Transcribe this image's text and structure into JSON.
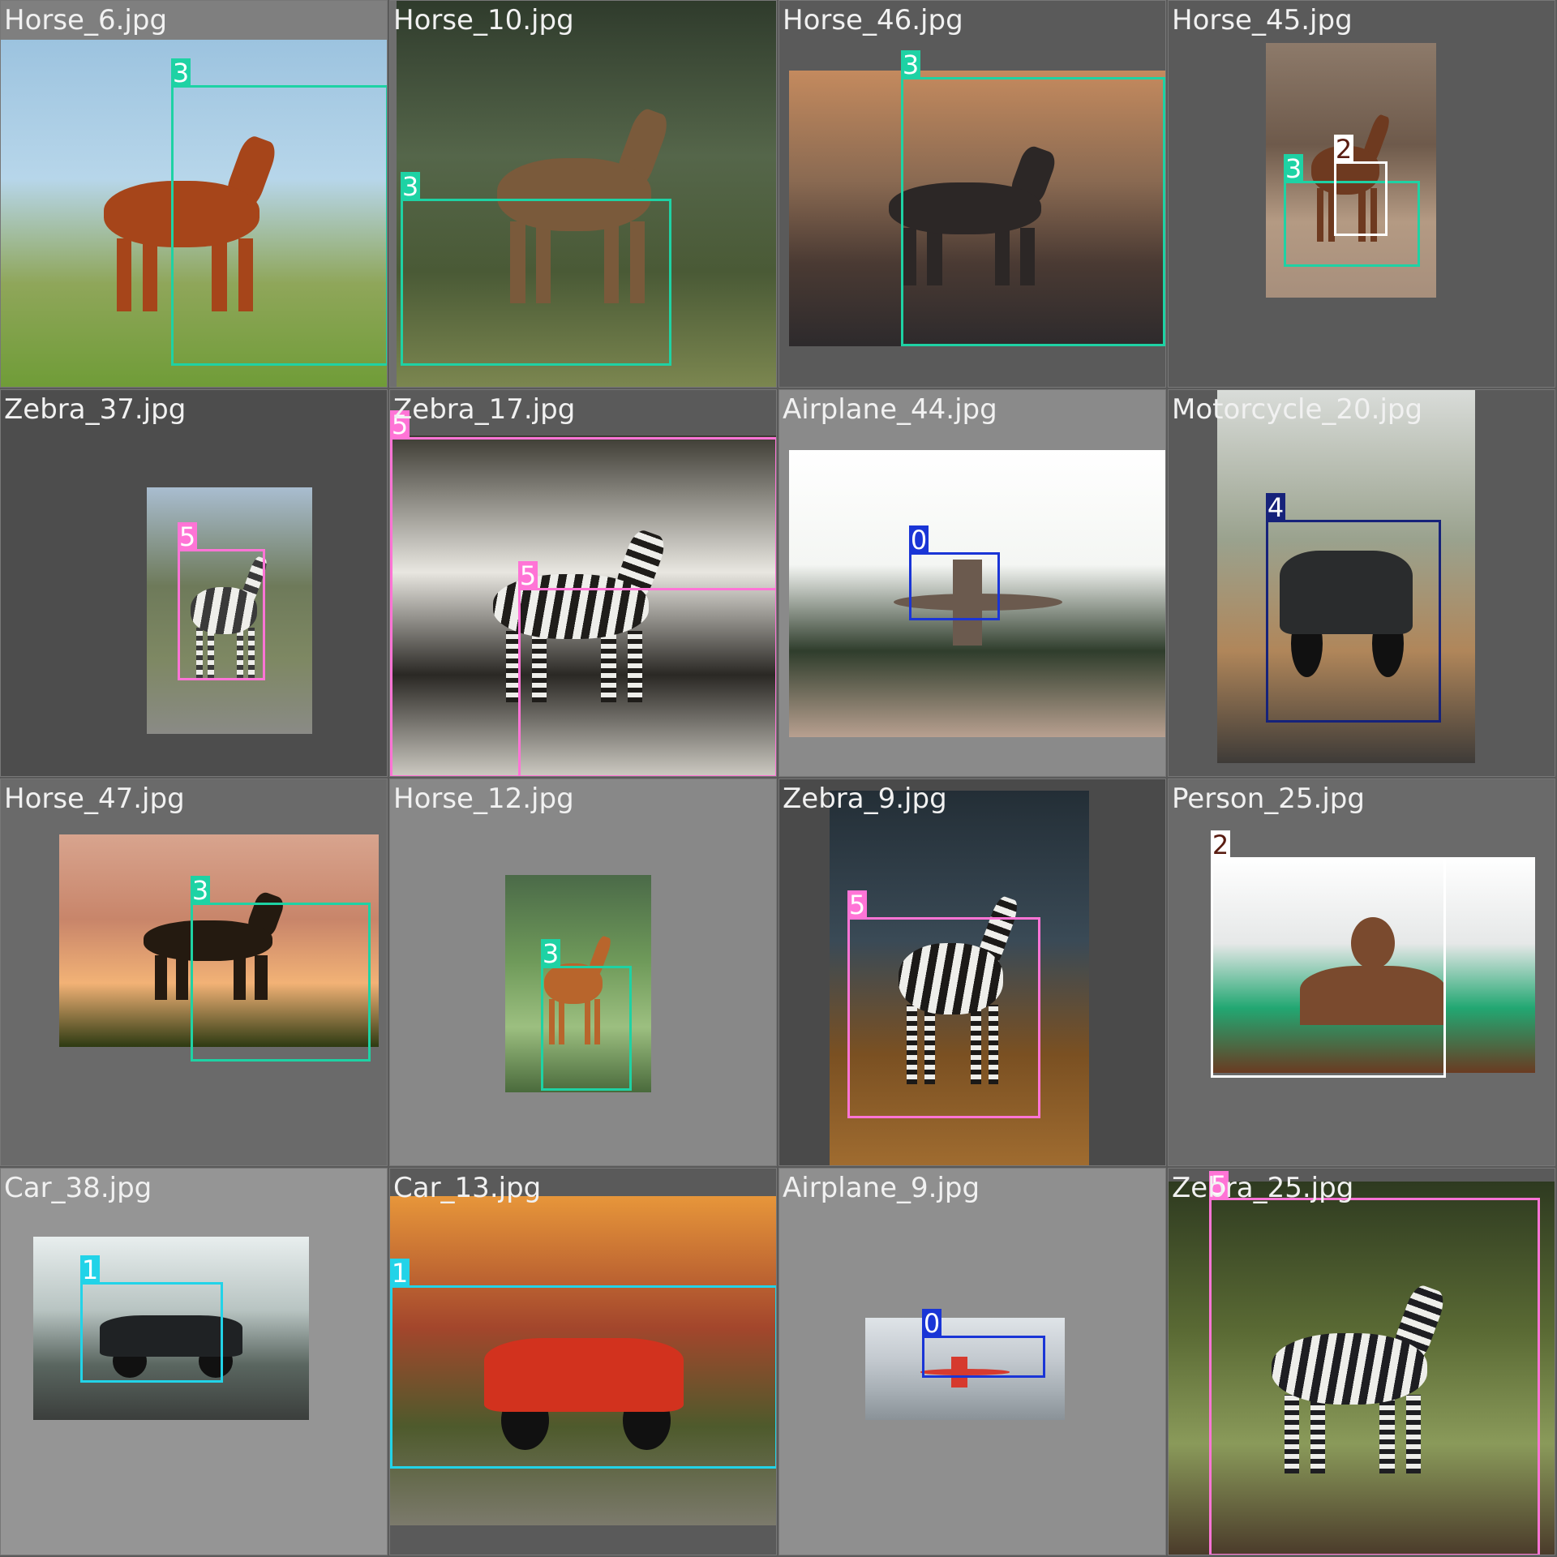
{
  "tiles": [
    {
      "filename": "Horse_6.jpg",
      "bg": "#7f7f7f",
      "photo_colors": [
        "#9cc3df",
        "#b7d6ea",
        "#8fa65a",
        "#6f9c37"
      ],
      "subject": "horse",
      "subject_color": "#a6451a",
      "boxes": [
        {
          "label": "3",
          "cls": 3
        }
      ]
    },
    {
      "filename": "Horse_10.jpg",
      "bg": "#6f6f6f",
      "photo_colors": [
        "#2f3b2c",
        "#55664a",
        "#4a5a36",
        "#7c8750"
      ],
      "subject": "horse",
      "subject_color": "#7a5a3b",
      "boxes": [
        {
          "label": "3",
          "cls": 3
        }
      ]
    },
    {
      "filename": "Horse_46.jpg",
      "bg": "#5a5a5a",
      "photo_colors": [
        "#c48a5e",
        "#8a6a52",
        "#4a3a33",
        "#2d2a2c"
      ],
      "subject": "horse",
      "subject_color": "#2c2726",
      "boxes": [
        {
          "label": "3",
          "cls": 3
        }
      ]
    },
    {
      "filename": "Horse_45.jpg",
      "bg": "#5a5a5a",
      "photo_colors": [
        "#8d7a6a",
        "#6e5a4b",
        "#b49a83",
        "#a78f7c"
      ],
      "subject": "horse",
      "subject_color": "#6e3a20",
      "boxes": [
        {
          "label": "3",
          "cls": 3
        },
        {
          "label": "2",
          "cls": 2
        }
      ]
    },
    {
      "filename": "Zebra_37.jpg",
      "bg": "#4d4d4d",
      "photo_colors": [
        "#a9bdd0",
        "#6e7a5a",
        "#7e8863",
        "#8a8a86"
      ],
      "subject": "zebra",
      "subject_color": "#3a3a3a",
      "boxes": [
        {
          "label": "5",
          "cls": 5
        }
      ]
    },
    {
      "filename": "Zebra_17.jpg",
      "bg": "#5a5a5a",
      "photo_colors": [
        "#3d3b33",
        "#e8e6e0",
        "#2a2824",
        "#cfccc4"
      ],
      "subject": "zebra",
      "subject_color": "#1f1d1a",
      "boxes": [
        {
          "label": "5",
          "cls": 5
        },
        {
          "label": "5",
          "cls": 5
        }
      ]
    },
    {
      "filename": "Airplane_44.jpg",
      "bg": "#8a8a8a",
      "photo_colors": [
        "#ffffff",
        "#f4f6f3",
        "#2f3d2c",
        "#b8a090"
      ],
      "subject": "airplane",
      "subject_color": "#6b5a4e",
      "boxes": [
        {
          "label": "0",
          "cls": 0
        }
      ]
    },
    {
      "filename": "Motorcycle_20.jpg",
      "bg": "#5a5a5a",
      "photo_colors": [
        "#d9dcd9",
        "#9aa28e",
        "#b0865a",
        "#3e3b38"
      ],
      "subject": "motorcycle",
      "subject_color": "#2a2c2d",
      "boxes": [
        {
          "label": "4",
          "cls": 4
        }
      ]
    },
    {
      "filename": "Horse_47.jpg",
      "bg": "#6a6a6a",
      "photo_colors": [
        "#d8a48e",
        "#c8856a",
        "#f2b276",
        "#2d3a12"
      ],
      "subject": "horse",
      "subject_color": "#241a10",
      "boxes": [
        {
          "label": "3",
          "cls": 3
        }
      ]
    },
    {
      "filename": "Horse_12.jpg",
      "bg": "#888888",
      "photo_colors": [
        "#4b6a48",
        "#6f9a5a",
        "#9cbf80",
        "#4a6a3c"
      ],
      "subject": "horse",
      "subject_color": "#b8652c",
      "boxes": [
        {
          "label": "3",
          "cls": 3
        }
      ]
    },
    {
      "filename": "Zebra_9.jpg",
      "bg": "#4a4a4a",
      "photo_colors": [
        "#232e36",
        "#3a4a56",
        "#7a5022",
        "#a06c30"
      ],
      "subject": "zebra",
      "subject_color": "#1c1a18",
      "boxes": [
        {
          "label": "5",
          "cls": 5
        }
      ]
    },
    {
      "filename": "Person_25.jpg",
      "bg": "#6a6a6a",
      "photo_colors": [
        "#ffffff",
        "#e6e8e8",
        "#22a772",
        "#6a3b22"
      ],
      "subject": "person",
      "subject_color": "#7a4a2e",
      "boxes": [
        {
          "label": "2",
          "cls": 2
        }
      ]
    },
    {
      "filename": "Car_38.jpg",
      "bg": "#959595",
      "photo_colors": [
        "#e8eeee",
        "#b8c4c2",
        "#5a6660",
        "#3b3e3c"
      ],
      "subject": "car",
      "subject_color": "#1f2224",
      "boxes": [
        {
          "label": "1",
          "cls": 1
        }
      ]
    },
    {
      "filename": "Car_13.jpg",
      "bg": "#5a5a5a",
      "photo_colors": [
        "#e7963a",
        "#a3462c",
        "#4e5a2c",
        "#7c7a6c"
      ],
      "subject": "car",
      "subject_color": "#d2321e",
      "boxes": [
        {
          "label": "1",
          "cls": 1
        }
      ]
    },
    {
      "filename": "Airplane_9.jpg",
      "bg": "#8f8f8f",
      "photo_colors": [
        "#dfe4e8",
        "#c4cad0",
        "#a8b0b6",
        "#8a9298"
      ],
      "subject": "airplane",
      "subject_color": "#d63a2e",
      "boxes": [
        {
          "label": "0",
          "cls": 0
        }
      ]
    },
    {
      "filename": "Zebra_25.jpg",
      "bg": "#5a5a5a",
      "photo_colors": [
        "#2e3a20",
        "#5a6a34",
        "#8a9a5a",
        "#4a3a2a"
      ],
      "subject": "zebra",
      "subject_color": "#1e1e22",
      "boxes": [
        {
          "label": "5",
          "cls": 5
        }
      ]
    }
  ]
}
